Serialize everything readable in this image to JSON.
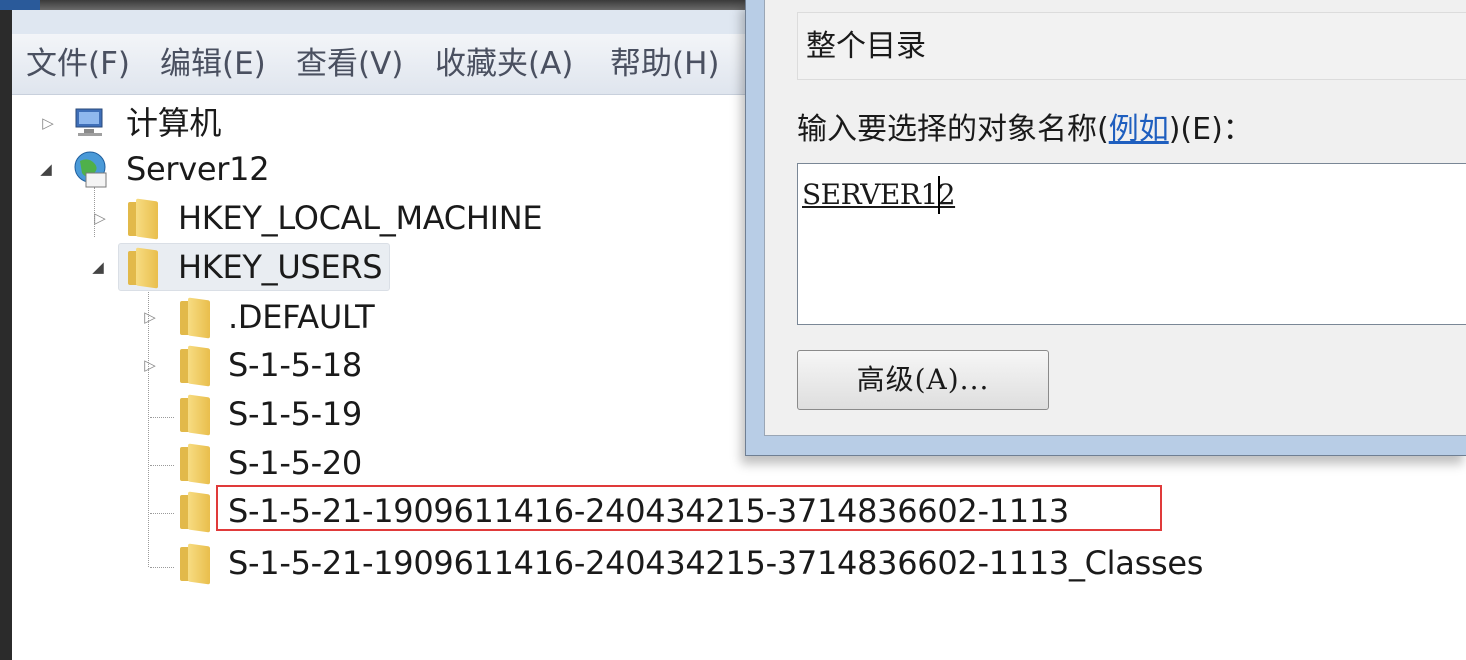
{
  "menu": {
    "items": [
      "文件(F)",
      "编辑(E)",
      "查看(V)",
      "收藏夹(A)",
      "帮助(H)"
    ]
  },
  "tree": {
    "computer": "计算机",
    "server": "Server12",
    "hklm": "HKEY_LOCAL_MACHINE",
    "hku": "HKEY_USERS",
    "children": [
      ".DEFAULT",
      "S-1-5-18",
      "S-1-5-19",
      "S-1-5-20",
      "S-1-5-21-1909611416-240434215-3714836602-1113",
      "S-1-5-21-1909611416-240434215-3714836602-1113_Classes"
    ]
  },
  "dialog": {
    "location": "整个目录",
    "object_label_prefix": "输入要选择的对象名称(",
    "object_label_link": "例如",
    "object_label_suffix": ")(E)：",
    "object_value": "SERVER12",
    "advanced_button": "高级(A)..."
  },
  "colors": {
    "highlight_box": "#e03a3a",
    "link": "#1f5fbf",
    "selected_row": "#e9edf2"
  }
}
